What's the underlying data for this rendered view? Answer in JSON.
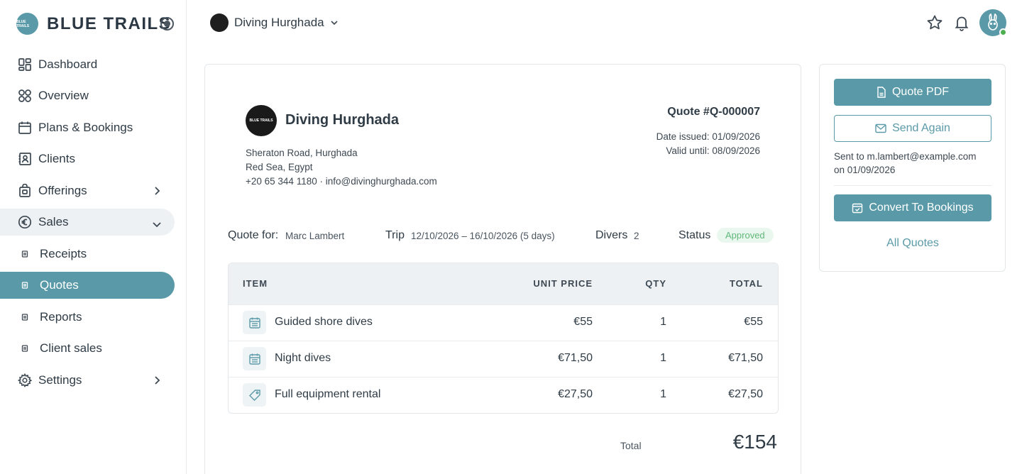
{
  "brand": {
    "name": "BLUE TRAILS",
    "logo_text": "BLUE TRAILS"
  },
  "sidebar": {
    "items": [
      {
        "label": "Dashboard",
        "icon": "dashboard-icon"
      },
      {
        "label": "Overview",
        "icon": "overview-icon"
      },
      {
        "label": "Plans & Bookings",
        "icon": "calendar-icon"
      },
      {
        "label": "Clients",
        "icon": "clients-icon"
      },
      {
        "label": "Offerings",
        "icon": "offerings-icon"
      },
      {
        "label": "Sales",
        "icon": "sales-icon"
      },
      {
        "label": "Receipts",
        "icon": "receipts-icon"
      },
      {
        "label": "Quotes",
        "icon": "quotes-icon"
      },
      {
        "label": "Reports",
        "icon": "reports-icon"
      },
      {
        "label": "Client sales",
        "icon": "client-sales-icon"
      },
      {
        "label": "Settings",
        "icon": "gear-icon"
      }
    ]
  },
  "topbar": {
    "org_name": "Diving Hurghada"
  },
  "quote": {
    "business": {
      "name": "Diving Hurghada",
      "logo_text": "BLUE TRAILS",
      "address_line1": "Sheraton Road, Hurghada",
      "address_line2": "Red Sea, Egypt",
      "contact": "+20 65 344 1180 · info@divinghurghada.com"
    },
    "number": "Quote #Q-000007",
    "date_issued": "Date issued: 01/09/2026",
    "valid_until": "Valid until: 08/09/2026",
    "quote_for_label": "Quote for:",
    "quote_for": "Marc Lambert",
    "trip_label": "Trip",
    "trip": "12/10/2026 – 16/10/2026 (5 days)",
    "divers_label": "Divers",
    "divers": "2",
    "status_label": "Status",
    "status": "Approved",
    "table": {
      "headers": {
        "item": "ITEM",
        "unit_price": "UNIT PRICE",
        "qty": "QTY",
        "total": "TOTAL"
      },
      "rows": [
        {
          "name": "Guided shore dives",
          "icon": "calendar-icon",
          "unit_price": "€55",
          "qty": "1",
          "total": "€55"
        },
        {
          "name": "Night dives",
          "icon": "calendar-icon",
          "unit_price": "€71,50",
          "qty": "1",
          "total": "€71,50"
        },
        {
          "name": "Full equipment rental",
          "icon": "tag-icon",
          "unit_price": "€27,50",
          "qty": "1",
          "total": "€27,50"
        }
      ]
    },
    "total_label": "Total",
    "total": "€154"
  },
  "actions": {
    "quote_pdf": "Quote PDF",
    "send_again": "Send Again",
    "sent_to": "Sent to m.lambert@example.com",
    "sent_on": "on 01/09/2026",
    "convert": "Convert To Bookings",
    "all_quotes": "All Quotes"
  },
  "colors": {
    "accent": "#5a9aa8",
    "approved": "#5fb87a",
    "approved_bg": "#eaf7ee"
  }
}
